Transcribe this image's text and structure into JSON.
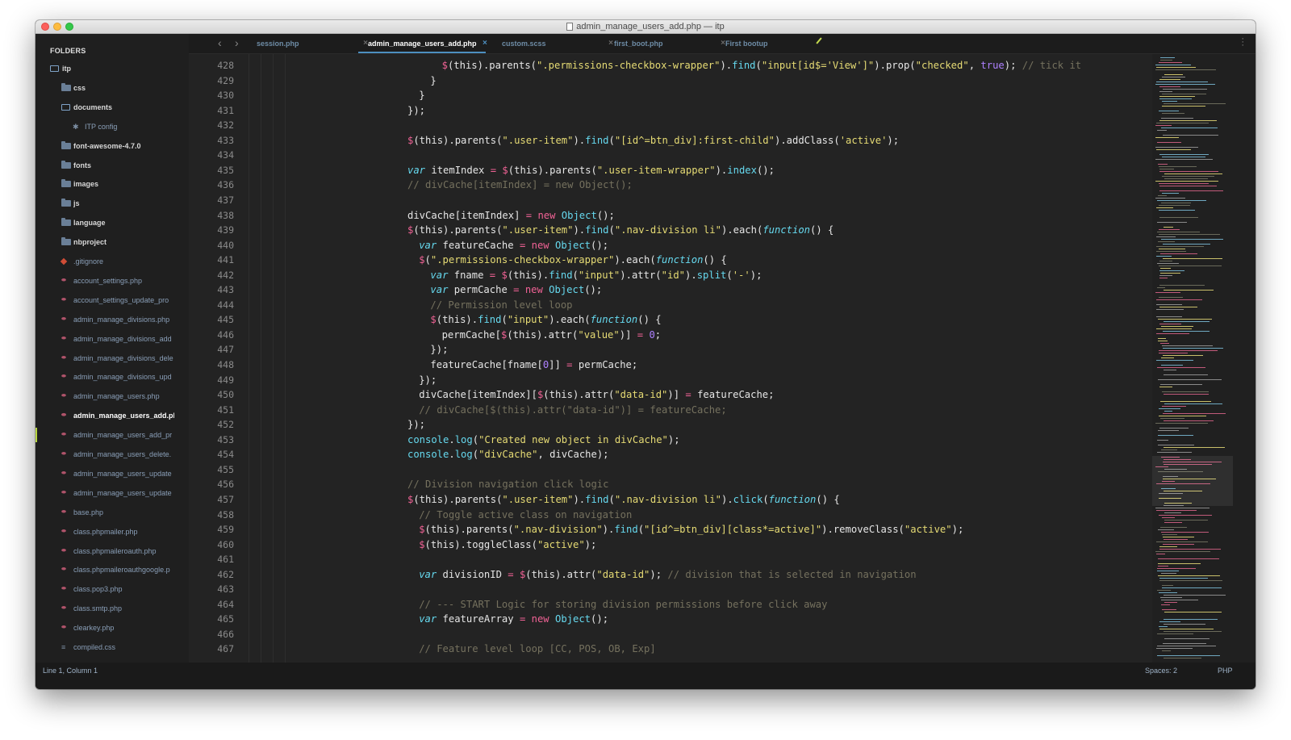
{
  "window": {
    "title": "admin_manage_users_add.php — itp"
  },
  "sidebar": {
    "header": "FOLDERS",
    "items": [
      {
        "label": "itp",
        "type": "folder-open",
        "depth": 0
      },
      {
        "label": "css",
        "type": "folder",
        "depth": 1
      },
      {
        "label": "documents",
        "type": "folder-open",
        "depth": 1
      },
      {
        "label": "ITP config",
        "type": "star",
        "depth": 2
      },
      {
        "label": "font-awesome-4.7.0",
        "type": "folder",
        "depth": 1
      },
      {
        "label": "fonts",
        "type": "folder",
        "depth": 1
      },
      {
        "label": "images",
        "type": "folder",
        "depth": 1
      },
      {
        "label": "js",
        "type": "folder",
        "depth": 1
      },
      {
        "label": "language",
        "type": "folder",
        "depth": 1
      },
      {
        "label": "nbproject",
        "type": "folder",
        "depth": 1
      },
      {
        "label": ".gitignore",
        "type": "git",
        "depth": 1
      },
      {
        "label": "account_settings.php",
        "type": "php",
        "depth": 1
      },
      {
        "label": "account_settings_update_pro",
        "type": "php",
        "depth": 1
      },
      {
        "label": "admin_manage_divisions.php",
        "type": "php",
        "depth": 1
      },
      {
        "label": "admin_manage_divisions_add",
        "type": "php",
        "depth": 1
      },
      {
        "label": "admin_manage_divisions_dele",
        "type": "php",
        "depth": 1
      },
      {
        "label": "admin_manage_divisions_upd",
        "type": "php",
        "depth": 1
      },
      {
        "label": "admin_manage_users.php",
        "type": "php",
        "depth": 1
      },
      {
        "label": "admin_manage_users_add.ph",
        "type": "php",
        "depth": 1,
        "active": true
      },
      {
        "label": "admin_manage_users_add_pr",
        "type": "php",
        "depth": 1
      },
      {
        "label": "admin_manage_users_delete.",
        "type": "php",
        "depth": 1
      },
      {
        "label": "admin_manage_users_update",
        "type": "php",
        "depth": 1
      },
      {
        "label": "admin_manage_users_update",
        "type": "php",
        "depth": 1
      },
      {
        "label": "base.php",
        "type": "php",
        "depth": 1
      },
      {
        "label": "class.phpmailer.php",
        "type": "php",
        "depth": 1
      },
      {
        "label": "class.phpmaileroauth.php",
        "type": "php",
        "depth": 1
      },
      {
        "label": "class.phpmaileroauthgoogle.p",
        "type": "php",
        "depth": 1
      },
      {
        "label": "class.pop3.php",
        "type": "php",
        "depth": 1
      },
      {
        "label": "class.smtp.php",
        "type": "php",
        "depth": 1
      },
      {
        "label": "clearkey.php",
        "type": "php",
        "depth": 1
      },
      {
        "label": "compiled.css",
        "type": "css",
        "depth": 1
      }
    ]
  },
  "tabs": [
    {
      "label": "session.php",
      "close": "×",
      "active": false
    },
    {
      "label": "admin_manage_users_add.php",
      "close": "×",
      "active": true
    },
    {
      "label": "custom.scss",
      "close": "×",
      "active": false
    },
    {
      "label": "first_boot.php",
      "close": "×",
      "active": false
    },
    {
      "label": "First bootup",
      "close": "",
      "active": false
    }
  ],
  "nav": {
    "back": "‹",
    "forward": "›"
  },
  "editor": {
    "lines": [
      {
        "n": "428",
        "indent": 3,
        "tokens": [
          [
            "dol",
            "$"
          ],
          [
            "t",
            "(this).parents("
          ],
          [
            "str",
            "\".permissions-checkbox-wrapper\""
          ],
          [
            "t",
            ")."
          ],
          [
            "fn",
            "find"
          ],
          [
            "t",
            "("
          ],
          [
            "str",
            "\"input[id$='View']\""
          ],
          [
            "t",
            ").prop("
          ],
          [
            "str",
            "\"checked\""
          ],
          [
            "t",
            ", "
          ],
          [
            "lit",
            "true"
          ],
          [
            "t",
            "); "
          ],
          [
            "cm",
            "// tick it"
          ]
        ]
      },
      {
        "n": "429",
        "indent": 2,
        "tokens": [
          [
            "t",
            "}"
          ]
        ]
      },
      {
        "n": "430",
        "indent": 1,
        "tokens": [
          [
            "t",
            "}"
          ]
        ]
      },
      {
        "n": "431",
        "indent": 0,
        "tokens": [
          [
            "t",
            "});"
          ]
        ]
      },
      {
        "n": "432",
        "indent": 0,
        "tokens": []
      },
      {
        "n": "433",
        "indent": 0,
        "tokens": [
          [
            "dol",
            "$"
          ],
          [
            "t",
            "(this).parents("
          ],
          [
            "str",
            "\".user-item\""
          ],
          [
            "t",
            ")."
          ],
          [
            "fn",
            "find"
          ],
          [
            "t",
            "("
          ],
          [
            "str",
            "\"[id^=btn_div]:first-child\""
          ],
          [
            "t",
            ").addClass("
          ],
          [
            "str",
            "'active'"
          ],
          [
            "t",
            ");"
          ]
        ]
      },
      {
        "n": "434",
        "indent": 0,
        "tokens": []
      },
      {
        "n": "435",
        "indent": 0,
        "tokens": [
          [
            "kw",
            "var"
          ],
          [
            "t",
            " itemIndex "
          ],
          [
            "op",
            "="
          ],
          [
            "t",
            " "
          ],
          [
            "dol",
            "$"
          ],
          [
            "t",
            "(this).parents("
          ],
          [
            "str",
            "\".user-item-wrapper\""
          ],
          [
            "t",
            ")."
          ],
          [
            "fn",
            "index"
          ],
          [
            "t",
            "();"
          ]
        ]
      },
      {
        "n": "436",
        "indent": 0,
        "tokens": [
          [
            "cm",
            "// divCache[itemIndex] = new Object();"
          ]
        ]
      },
      {
        "n": "437",
        "indent": 0,
        "tokens": []
      },
      {
        "n": "438",
        "indent": 0,
        "tokens": [
          [
            "t",
            "divCache[itemIndex] "
          ],
          [
            "op",
            "="
          ],
          [
            "t",
            " "
          ],
          [
            "kw2",
            "new"
          ],
          [
            "t",
            " "
          ],
          [
            "fn",
            "Object"
          ],
          [
            "t",
            "();"
          ]
        ]
      },
      {
        "n": "439",
        "indent": 0,
        "tokens": [
          [
            "dol",
            "$"
          ],
          [
            "t",
            "(this).parents("
          ],
          [
            "str",
            "\".user-item\""
          ],
          [
            "t",
            ")."
          ],
          [
            "fn",
            "find"
          ],
          [
            "t",
            "("
          ],
          [
            "str",
            "\".nav-division li\""
          ],
          [
            "t",
            ").each("
          ],
          [
            "kw",
            "function"
          ],
          [
            "t",
            "() {"
          ]
        ]
      },
      {
        "n": "440",
        "indent": 1,
        "tokens": [
          [
            "kw",
            "var"
          ],
          [
            "t",
            " featureCache "
          ],
          [
            "op",
            "="
          ],
          [
            "t",
            " "
          ],
          [
            "kw2",
            "new"
          ],
          [
            "t",
            " "
          ],
          [
            "fn",
            "Object"
          ],
          [
            "t",
            "();"
          ]
        ]
      },
      {
        "n": "441",
        "indent": 1,
        "tokens": [
          [
            "dol",
            "$"
          ],
          [
            "t",
            "("
          ],
          [
            "str",
            "\".permissions-checkbox-wrapper\""
          ],
          [
            "t",
            ").each("
          ],
          [
            "kw",
            "function"
          ],
          [
            "t",
            "() {"
          ]
        ]
      },
      {
        "n": "442",
        "indent": 2,
        "tokens": [
          [
            "kw",
            "var"
          ],
          [
            "t",
            " fname "
          ],
          [
            "op",
            "="
          ],
          [
            "t",
            " "
          ],
          [
            "dol",
            "$"
          ],
          [
            "t",
            "(this)."
          ],
          [
            "fn",
            "find"
          ],
          [
            "t",
            "("
          ],
          [
            "str",
            "\"input\""
          ],
          [
            "t",
            ").attr("
          ],
          [
            "str",
            "\"id\""
          ],
          [
            "t",
            ")."
          ],
          [
            "fn",
            "split"
          ],
          [
            "t",
            "("
          ],
          [
            "str",
            "'-'"
          ],
          [
            "t",
            ");"
          ]
        ]
      },
      {
        "n": "443",
        "indent": 2,
        "tokens": [
          [
            "kw",
            "var"
          ],
          [
            "t",
            " permCache "
          ],
          [
            "op",
            "="
          ],
          [
            "t",
            " "
          ],
          [
            "kw2",
            "new"
          ],
          [
            "t",
            " "
          ],
          [
            "fn",
            "Object"
          ],
          [
            "t",
            "();"
          ]
        ]
      },
      {
        "n": "444",
        "indent": 2,
        "tokens": [
          [
            "cm",
            "// Permission level loop"
          ]
        ]
      },
      {
        "n": "445",
        "indent": 2,
        "tokens": [
          [
            "dol",
            "$"
          ],
          [
            "t",
            "(this)."
          ],
          [
            "fn",
            "find"
          ],
          [
            "t",
            "("
          ],
          [
            "str",
            "\"input\""
          ],
          [
            "t",
            ").each("
          ],
          [
            "kw",
            "function"
          ],
          [
            "t",
            "() {"
          ]
        ]
      },
      {
        "n": "446",
        "indent": 3,
        "tokens": [
          [
            "t",
            "permCache["
          ],
          [
            "dol",
            "$"
          ],
          [
            "t",
            "(this).attr("
          ],
          [
            "str",
            "\"value\""
          ],
          [
            "t",
            ")] "
          ],
          [
            "op",
            "="
          ],
          [
            "t",
            " "
          ],
          [
            "num",
            "0"
          ],
          [
            "t",
            ";"
          ]
        ]
      },
      {
        "n": "447",
        "indent": 2,
        "tokens": [
          [
            "t",
            "});"
          ]
        ]
      },
      {
        "n": "448",
        "indent": 2,
        "tokens": [
          [
            "t",
            "featureCache[fname["
          ],
          [
            "num",
            "0"
          ],
          [
            "t",
            "]] "
          ],
          [
            "op",
            "="
          ],
          [
            "t",
            " permCache;"
          ]
        ]
      },
      {
        "n": "449",
        "indent": 1,
        "tokens": [
          [
            "t",
            "});"
          ]
        ]
      },
      {
        "n": "450",
        "indent": 1,
        "tokens": [
          [
            "t",
            "divCache[itemIndex]["
          ],
          [
            "dol",
            "$"
          ],
          [
            "t",
            "(this).attr("
          ],
          [
            "str",
            "\"data-id\""
          ],
          [
            "t",
            ")] "
          ],
          [
            "op",
            "="
          ],
          [
            "t",
            " featureCache;"
          ]
        ]
      },
      {
        "n": "451",
        "indent": 1,
        "tokens": [
          [
            "cm",
            "// divCache[$(this).attr(\"data-id\")] = featureCache;"
          ]
        ]
      },
      {
        "n": "452",
        "indent": 0,
        "tokens": [
          [
            "t",
            "});"
          ]
        ]
      },
      {
        "n": "453",
        "indent": 0,
        "tokens": [
          [
            "fn",
            "console"
          ],
          [
            "t",
            "."
          ],
          [
            "fn",
            "log"
          ],
          [
            "t",
            "("
          ],
          [
            "str",
            "\"Created new object in divCache\""
          ],
          [
            "t",
            ");"
          ]
        ]
      },
      {
        "n": "454",
        "indent": 0,
        "tokens": [
          [
            "fn",
            "console"
          ],
          [
            "t",
            "."
          ],
          [
            "fn",
            "log"
          ],
          [
            "t",
            "("
          ],
          [
            "str",
            "\"divCache\""
          ],
          [
            "t",
            ", divCache);"
          ]
        ]
      },
      {
        "n": "455",
        "indent": 0,
        "tokens": []
      },
      {
        "n": "456",
        "indent": 0,
        "tokens": [
          [
            "cm",
            "// Division navigation click logic"
          ]
        ]
      },
      {
        "n": "457",
        "indent": 0,
        "tokens": [
          [
            "dol",
            "$"
          ],
          [
            "t",
            "(this).parents("
          ],
          [
            "str",
            "\".user-item\""
          ],
          [
            "t",
            ")."
          ],
          [
            "fn",
            "find"
          ],
          [
            "t",
            "("
          ],
          [
            "str",
            "\".nav-division li\""
          ],
          [
            "t",
            ")."
          ],
          [
            "fn",
            "click"
          ],
          [
            "t",
            "("
          ],
          [
            "kw",
            "function"
          ],
          [
            "t",
            "() {"
          ]
        ]
      },
      {
        "n": "458",
        "indent": 1,
        "tokens": [
          [
            "cm",
            "// Toggle active class on navigation"
          ]
        ]
      },
      {
        "n": "459",
        "indent": 1,
        "tokens": [
          [
            "dol",
            "$"
          ],
          [
            "t",
            "(this).parents("
          ],
          [
            "str",
            "\".nav-division\""
          ],
          [
            "t",
            ")."
          ],
          [
            "fn",
            "find"
          ],
          [
            "t",
            "("
          ],
          [
            "str",
            "\"[id^=btn_div][class*=active]\""
          ],
          [
            "t",
            ").removeClass("
          ],
          [
            "str",
            "\"active\""
          ],
          [
            "t",
            ");"
          ]
        ]
      },
      {
        "n": "460",
        "indent": 1,
        "tokens": [
          [
            "dol",
            "$"
          ],
          [
            "t",
            "(this).toggleClass("
          ],
          [
            "str",
            "\"active\""
          ],
          [
            "t",
            ");"
          ]
        ]
      },
      {
        "n": "461",
        "indent": 0,
        "tokens": []
      },
      {
        "n": "462",
        "indent": 1,
        "tokens": [
          [
            "kw",
            "var"
          ],
          [
            "t",
            " divisionID "
          ],
          [
            "op",
            "="
          ],
          [
            "t",
            " "
          ],
          [
            "dol",
            "$"
          ],
          [
            "t",
            "(this).attr("
          ],
          [
            "str",
            "\"data-id\""
          ],
          [
            "t",
            "); "
          ],
          [
            "cm",
            "// division that is selected in navigation"
          ]
        ]
      },
      {
        "n": "463",
        "indent": 0,
        "tokens": []
      },
      {
        "n": "464",
        "indent": 1,
        "tokens": [
          [
            "cm",
            "// --- START Logic for storing division permissions before click away"
          ]
        ]
      },
      {
        "n": "465",
        "indent": 1,
        "tokens": [
          [
            "kw",
            "var"
          ],
          [
            "t",
            " featureArray "
          ],
          [
            "op",
            "="
          ],
          [
            "t",
            " "
          ],
          [
            "kw2",
            "new"
          ],
          [
            "t",
            " "
          ],
          [
            "fn",
            "Object"
          ],
          [
            "t",
            "();"
          ]
        ]
      },
      {
        "n": "466",
        "indent": 0,
        "tokens": []
      },
      {
        "n": "467",
        "indent": 1,
        "tokens": [
          [
            "cm",
            "// Feature level loop [CC, POS, OB, Exp]"
          ]
        ]
      }
    ]
  },
  "status": {
    "position": "Line 1, Column 1",
    "spaces": "Spaces: 2",
    "syntax": "PHP"
  },
  "colors": {
    "background": "#232323",
    "keyword": "#66d9ef",
    "string": "#e6db74",
    "comment": "#75715e",
    "operator": "#f06295",
    "number": "#ae81ff",
    "tab_accent": "#4d8fc0"
  }
}
